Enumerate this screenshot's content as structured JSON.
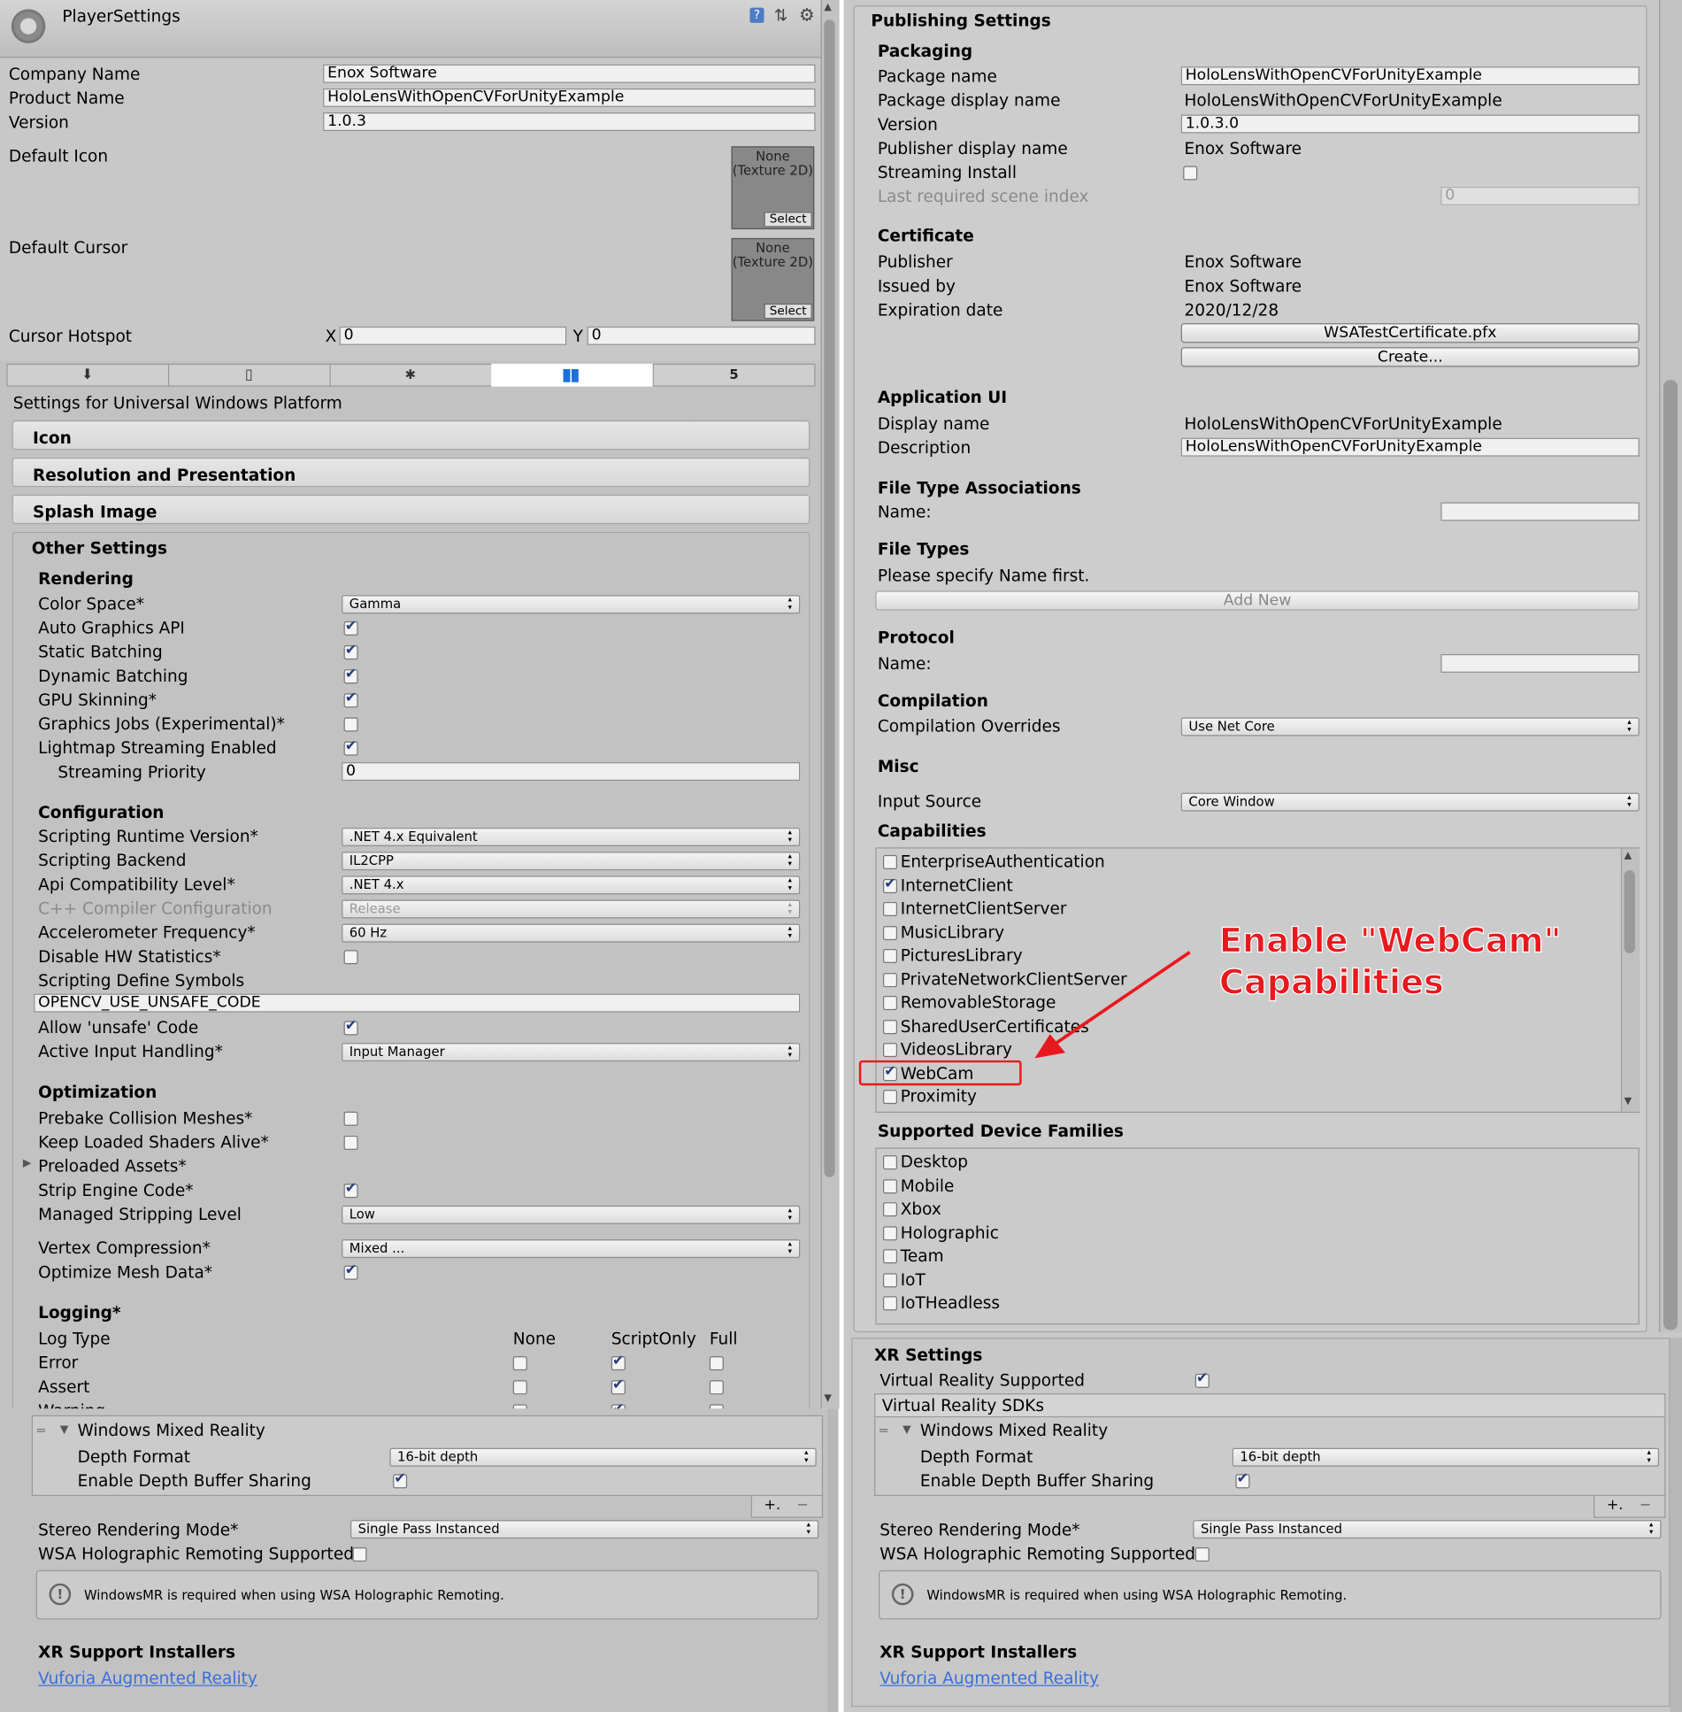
{
  "header": {
    "title": "PlayerSettings"
  },
  "left": {
    "company_label": "Company Name",
    "company_value": "Enox Software",
    "product_label": "Product Name",
    "product_value": "HoloLensWithOpenCVForUnityExample",
    "version_label": "Version",
    "version_value": "1.0.3",
    "default_icon_label": "Default Icon",
    "default_cursor_label": "Default Cursor",
    "texture_none": "None",
    "texture_type": "(Texture 2D)",
    "select": "Select",
    "cursor_hotspot_label": "Cursor Hotspot",
    "x_label": "X",
    "x_value": "0",
    "y_label": "Y",
    "y_value": "0",
    "platform_title": "Settings for Universal Windows Platform",
    "icon_section": "Icon",
    "resolution_section": "Resolution and Presentation",
    "splash_section": "Splash Image",
    "other_section": "Other Settings",
    "rendering": {
      "title": "Rendering",
      "color_space": "Color Space*",
      "color_space_value": "Gamma",
      "auto_graphics": "Auto Graphics API",
      "static_batching": "Static Batching",
      "dynamic_batching": "Dynamic Batching",
      "gpu_skinning": "GPU Skinning*",
      "graphics_jobs": "Graphics Jobs (Experimental)*",
      "lightmap_streaming": "Lightmap Streaming Enabled",
      "streaming_priority": "Streaming Priority",
      "streaming_priority_value": "0"
    },
    "configuration": {
      "title": "Configuration",
      "runtime_version": "Scripting Runtime Version*",
      "runtime_version_value": ".NET 4.x Equivalent",
      "backend": "Scripting Backend",
      "backend_value": "IL2CPP",
      "api_level": "Api Compatibility Level*",
      "api_level_value": ".NET 4.x",
      "cpp_config": "C++ Compiler Configuration",
      "cpp_config_value": "Release",
      "accel": "Accelerometer Frequency*",
      "accel_value": "60 Hz",
      "disable_hw": "Disable HW Statistics*",
      "define_symbols": "Scripting Define Symbols",
      "define_symbols_value": "OPENCV_USE_UNSAFE_CODE",
      "allow_unsafe": "Allow 'unsafe' Code",
      "input_handling": "Active Input Handling*",
      "input_handling_value": "Input Manager"
    },
    "optimization": {
      "title": "Optimization",
      "prebake": "Prebake Collision Meshes*",
      "keep_shaders": "Keep Loaded Shaders Alive*",
      "preloaded": "Preloaded Assets*",
      "strip": "Strip Engine Code*",
      "stripping_level": "Managed Stripping Level",
      "stripping_level_value": "Low",
      "vertex_compression": "Vertex Compression*",
      "vertex_compression_value": "Mixed ...",
      "optimize_mesh": "Optimize Mesh Data*"
    },
    "logging": {
      "title": "Logging*",
      "log_type": "Log Type",
      "none": "None",
      "script_only": "ScriptOnly",
      "full": "Full",
      "error": "Error",
      "assert": "Assert",
      "warning": "Warning"
    }
  },
  "xr": {
    "title": "XR Settings",
    "vr_supported": "Virtual Reality Supported",
    "vr_sdks": "Virtual Reality SDKs",
    "wmr": "Windows Mixed Reality",
    "depth_format": "Depth Format",
    "depth_format_value": "16-bit depth",
    "depth_sharing": "Enable Depth Buffer Sharing",
    "plus": "+.",
    "minus": "−",
    "stereo_mode": "Stereo Rendering Mode*",
    "stereo_mode_value": "Single Pass Instanced",
    "remoting": "WSA Holographic Remoting Supported",
    "warning": "WindowsMR is required when using WSA Holographic Remoting.",
    "installers": "XR Support Installers",
    "vuforia": "Vuforia Augmented Reality"
  },
  "right": {
    "publishing_title": "Publishing Settings",
    "packaging": {
      "title": "Packaging",
      "package_name": "Package name",
      "package_name_value": "HoloLensWithOpenCVForUnityExample",
      "display_name": "Package display name",
      "display_name_value": "HoloLensWithOpenCVForUnityExample",
      "version": "Version",
      "version_value": "1.0.3.0",
      "publisher_display": "Publisher display name",
      "publisher_display_value": "Enox Software",
      "streaming_install": "Streaming Install",
      "last_scene": "Last required scene index",
      "last_scene_value": "0"
    },
    "certificate": {
      "title": "Certificate",
      "publisher": "Publisher",
      "publisher_value": "Enox Software",
      "issued_by": "Issued by",
      "issued_by_value": "Enox Software",
      "expiration": "Expiration date",
      "expiration_value": "2020/12/28",
      "cert_file": "WSATestCertificate.pfx",
      "create": "Create..."
    },
    "app_ui": {
      "title": "Application UI",
      "display_name": "Display name",
      "display_name_value": "HoloLensWithOpenCVForUnityExample",
      "description": "Description",
      "description_value": "HoloLensWithOpenCVForUnityExample"
    },
    "fta": {
      "title": "File Type Associations",
      "name": "Name:"
    },
    "file_types": {
      "title": "File Types",
      "hint": "Please specify Name first.",
      "add_new": "Add New"
    },
    "protocol": {
      "title": "Protocol",
      "name": "Name:"
    },
    "compilation": {
      "title": "Compilation",
      "overrides": "Compilation Overrides",
      "overrides_value": "Use Net Core"
    },
    "misc": {
      "title": "Misc",
      "input_source": "Input Source",
      "input_source_value": "Core Window"
    },
    "capabilities": {
      "title": "Capabilities",
      "items": [
        {
          "label": "EnterpriseAuthentication",
          "checked": false
        },
        {
          "label": "InternetClient",
          "checked": true
        },
        {
          "label": "InternetClientServer",
          "checked": false
        },
        {
          "label": "MusicLibrary",
          "checked": false
        },
        {
          "label": "PicturesLibrary",
          "checked": false
        },
        {
          "label": "PrivateNetworkClientServer",
          "checked": false
        },
        {
          "label": "RemovableStorage",
          "checked": false
        },
        {
          "label": "SharedUserCertificates",
          "checked": false
        },
        {
          "label": "VideosLibrary",
          "checked": false
        },
        {
          "label": "WebCam",
          "checked": true
        },
        {
          "label": "Proximity",
          "checked": false
        }
      ]
    },
    "device_families": {
      "title": "Supported Device Families",
      "items": [
        {
          "label": "Desktop",
          "checked": false
        },
        {
          "label": "Mobile",
          "checked": false
        },
        {
          "label": "Xbox",
          "checked": false
        },
        {
          "label": "Holographic",
          "checked": false
        },
        {
          "label": "Team",
          "checked": false
        },
        {
          "label": "IoT",
          "checked": false
        },
        {
          "label": "IoTHeadless",
          "checked": false
        }
      ]
    }
  },
  "annotation": {
    "line1": "Enable \"WebCam\"",
    "line2": "Capabilities",
    "color": "#e8191e"
  }
}
